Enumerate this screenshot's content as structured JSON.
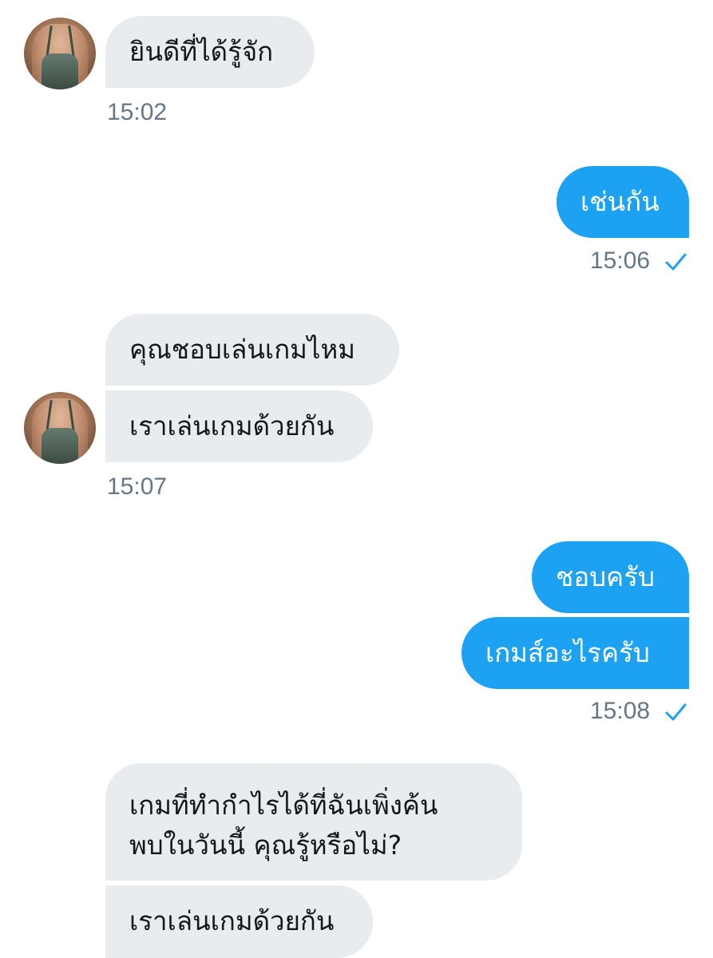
{
  "conversation": {
    "messages": [
      {
        "sender": "them",
        "text": "ยินดีที่ได้รู้จัก"
      },
      {
        "sender": "them",
        "time": "15:02"
      },
      {
        "sender": "me",
        "text": "เช่นกัน"
      },
      {
        "sender": "me",
        "time": "15:06",
        "status_icon": "check-icon"
      },
      {
        "sender": "them",
        "text": "คุณชอบเล่นเกมไหม"
      },
      {
        "sender": "them",
        "text": "เราเล่นเกมด้วยกัน"
      },
      {
        "sender": "them",
        "time": "15:07"
      },
      {
        "sender": "me",
        "text": "ชอบครับ"
      },
      {
        "sender": "me",
        "text": "เกมส์อะไรครับ"
      },
      {
        "sender": "me",
        "time": "15:08",
        "status_icon": "check-icon"
      },
      {
        "sender": "them",
        "text_lines": [
          "เกมที่ทำกำไรได้ที่ฉันเพิ่งค้น",
          "พบในวันนี้ คุณรู้หรือไม่?"
        ]
      },
      {
        "sender": "them",
        "text": "เราเล่นเกมด้วยกัน"
      }
    ]
  },
  "colors": {
    "incoming_bubble": "#e8ecef",
    "outgoing_bubble": "#1da1f2",
    "timestamp": "#657786",
    "check": "#1da1f2"
  }
}
